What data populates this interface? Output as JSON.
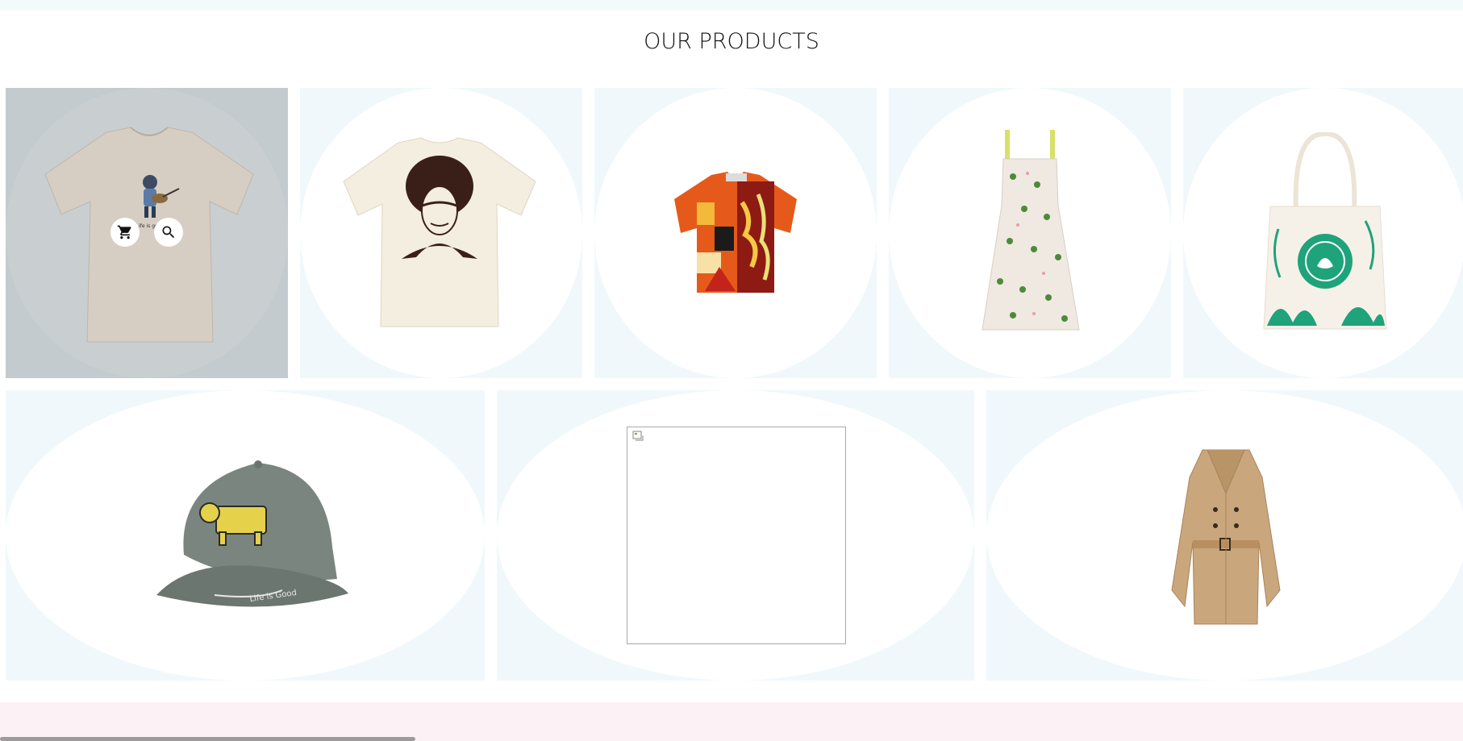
{
  "section": {
    "title": "OUR PRODUCTS"
  },
  "products": [
    {
      "name": "Graphic T-Shirt Beige",
      "icon": "tshirt-beige-guitar"
    },
    {
      "name": "Portrait T-Shirt Cream",
      "icon": "tshirt-cream-portrait"
    },
    {
      "name": "Printed Short-Sleeve Shirt",
      "icon": "patterned-shirt"
    },
    {
      "name": "Floral Sundress",
      "icon": "floral-dress"
    },
    {
      "name": "Printed Tote Bag",
      "icon": "tote-bag"
    },
    {
      "name": "Embroidered Cap",
      "icon": "cap-grey"
    },
    {
      "name": "Missing Image Product",
      "icon": "broken-image"
    },
    {
      "name": "Trench Coat",
      "icon": "trench-coat"
    }
  ],
  "actions": {
    "cart_icon": "cart-icon",
    "search_icon": "search-icon"
  },
  "colors": {
    "card_bg": "#f1f8fb",
    "hover_overlay": "#c3cbcf",
    "footer_band": "#fcf1f4"
  }
}
